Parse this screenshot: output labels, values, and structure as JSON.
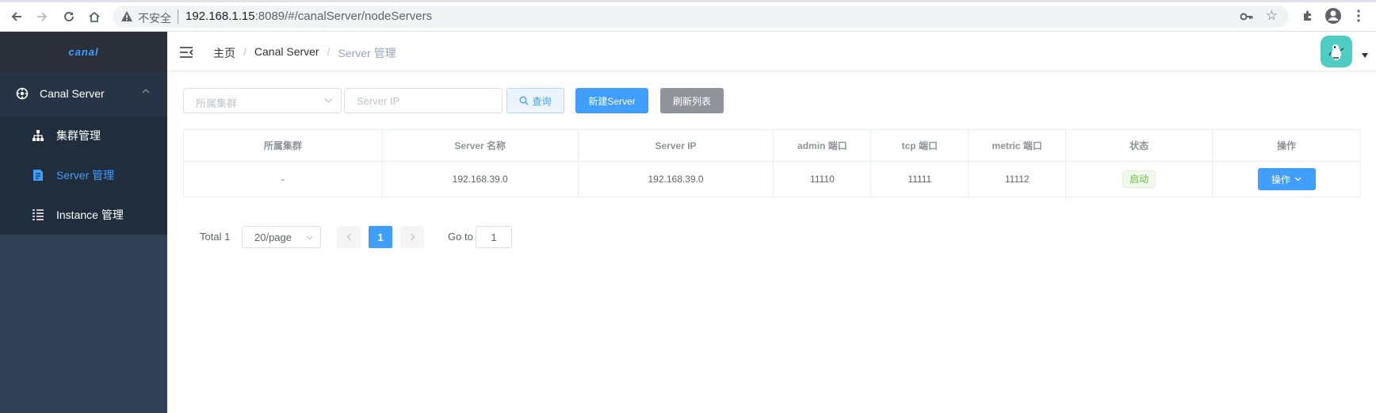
{
  "browser": {
    "security_label": "不安全",
    "url_host": "192.168.1.15",
    "url_rest": ":8089/#/canalServer/nodeServers"
  },
  "sidebar": {
    "logo": "canal",
    "parent": {
      "label": "Canal Server",
      "icon": "settings-icon",
      "expanded": true
    },
    "items": [
      {
        "label": "集群管理",
        "icon": "cluster-icon",
        "active": false
      },
      {
        "label": "Server 管理",
        "icon": "document-icon",
        "active": true
      },
      {
        "label": "Instance 管理",
        "icon": "list-icon",
        "active": false
      }
    ]
  },
  "header": {
    "breadcrumb": [
      "主页",
      "Canal Server",
      "Server 管理"
    ]
  },
  "filters": {
    "cluster_placeholder": "所属集群",
    "ip_placeholder": "Server IP",
    "search_label": "查询",
    "new_label": "新建Server",
    "refresh_label": "刷新列表"
  },
  "table": {
    "columns": [
      "所属集群",
      "Server 名称",
      "Server IP",
      "admin 端口",
      "tcp 端口",
      "metric 端口",
      "状态",
      "操作"
    ],
    "rows": [
      {
        "cluster": "-",
        "name": "192.168.39.0",
        "ip": "192.168.39.0",
        "admin_port": "11110",
        "tcp_port": "11111",
        "metric_port": "11112",
        "status": "启动",
        "action_label": "操作"
      }
    ]
  },
  "pagination": {
    "total_label": "Total 1",
    "page_size": "20/page",
    "current_page": "1",
    "goto_label": "Go to",
    "goto_value": "1"
  },
  "colors": {
    "primary": "#409eff",
    "sidebar_bg": "#304156",
    "success": "#67c23a",
    "info": "#909399"
  }
}
